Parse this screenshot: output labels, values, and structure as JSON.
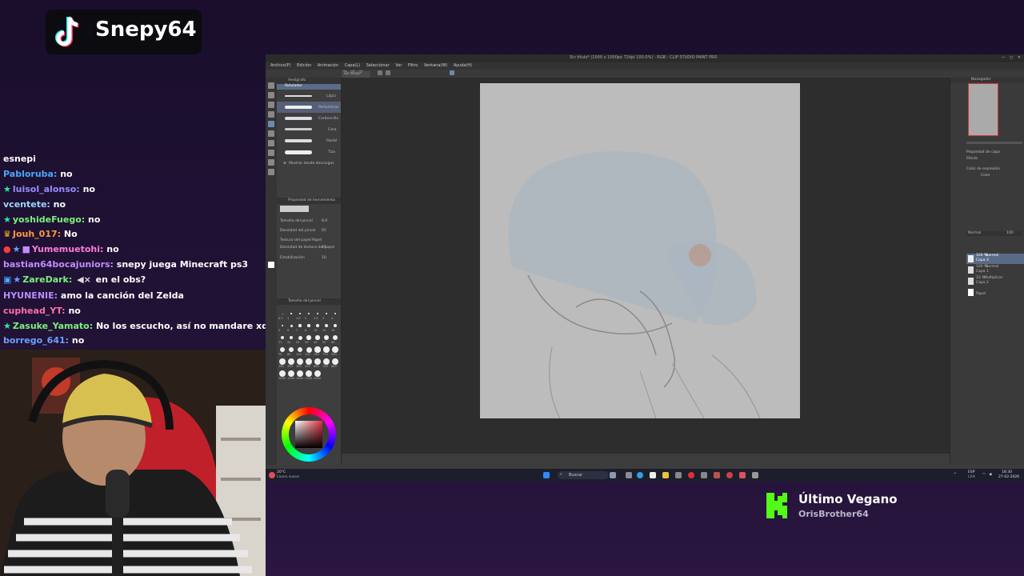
{
  "tiktok": {
    "username": "Snepy64",
    "icon": "tiktok-logo"
  },
  "chat": {
    "messages": [
      {
        "user": "esnepi",
        "text": "",
        "color": "#ffffff",
        "badges": []
      },
      {
        "user": "Pabloruba:",
        "text": "no",
        "color": "#4aa8ff",
        "badges": []
      },
      {
        "user": "luisol_alonso:",
        "text": "no",
        "color": "#9b8cff",
        "badges": [
          "star-icon"
        ]
      },
      {
        "user": "vcentete:",
        "text": "no",
        "color": "#9fd4ff",
        "badges": []
      },
      {
        "user": "yoshideFuego:",
        "text": "no",
        "color": "#7cf07c",
        "badges": [
          "star-icon"
        ]
      },
      {
        "user": "Jouh_017:",
        "text": "No",
        "color": "#ff9a3c",
        "badges": [
          "crown-icon"
        ]
      },
      {
        "user": "Yumemuetohi:",
        "text": "no",
        "color": "#ff7ad9",
        "badges": [
          "warning-icon",
          "star-icon",
          "gift-icon"
        ]
      },
      {
        "user": "bastian64bocajuniors:",
        "text": "snepy juega Minecraft ps3",
        "color": "#c58bff",
        "badges": []
      },
      {
        "user": "ZareDark:",
        "text": "en el obs?",
        "color": "#7cf07c",
        "badges": [
          "badge-icon",
          "star-icon"
        ],
        "extra": "mute-icon"
      },
      {
        "user": "HYUNENIE:",
        "text": "amo la canción del Zelda",
        "color": "#b98cff",
        "badges": []
      },
      {
        "user": "cuphead_YT:",
        "text": "no",
        "color": "#ff6fa8",
        "badges": []
      },
      {
        "user": "Zasuke_Yamato:",
        "text": "No los escucho, así no mandare xd",
        "color": "#7cf07c",
        "badges": [
          "star-icon"
        ]
      },
      {
        "user": "borrego_641:",
        "text": "no",
        "color": "#6aa0ff",
        "badges": []
      }
    ]
  },
  "csp": {
    "window_title": "Sin título* (1000 x 1000px 72dpi 100.0%) - RGB - CLIP STUDIO PAINT PRO",
    "menu": [
      "Archivo(F)",
      "Edición",
      "Animación",
      "Capa(L)",
      "Seleccionar",
      "Ver",
      "Filtro",
      "Ventana(W)",
      "Ayuda(H)"
    ],
    "subtool_header": "Aerógrafo",
    "brush_label": "Rotulador",
    "brush_names": [
      "Lápiz",
      "Portaminas",
      "Carboncillo",
      "Cera",
      "Pastel",
      "Tiza"
    ],
    "download_button": "Mostrar desde descargas",
    "tool_property_header": "Propiedad de herramienta",
    "properties": [
      {
        "label": "Tamaño del pincel",
        "value": "8.0"
      },
      {
        "label": "Densidad del pincel",
        "value": "65"
      },
      {
        "label": "Textura del papel",
        "value": "Papel"
      },
      {
        "label": "Densidad de textura del papel",
        "value": "45"
      },
      {
        "label": "Estabilización",
        "value": "10"
      }
    ],
    "brush_size_header": "Tamaño del pincel",
    "brush_sizes": [
      "0.7",
      "1",
      "1.5",
      "2",
      "2.5",
      "3",
      "4",
      "5",
      "6",
      "7",
      "8",
      "10",
      "12",
      "15",
      "17",
      "20",
      "25",
      "30",
      "40",
      "50",
      "60",
      "70",
      "80",
      "100",
      "120",
      "150",
      "170",
      "200",
      "250",
      "300",
      "400",
      "500",
      "600",
      "700",
      "800",
      "1000",
      "1200",
      "1500",
      "1700",
      "2000"
    ],
    "navigator_label": "Navegador",
    "layer_props_label": "Propiedad de capa",
    "effect_label": "Efecto",
    "expression_color_label": "Color de expresión",
    "expression_color_value": "Color",
    "layer_blend": "Normal",
    "layer_opacity": "100",
    "layers": [
      {
        "opacity": "100 %",
        "mode": "Normal",
        "name": "Capa 3"
      },
      {
        "opacity": "100 %",
        "mode": "Normal",
        "name": "Capa 1"
      },
      {
        "opacity": "23 %",
        "mode": "Multiplicar",
        "name": "Capa 2"
      },
      {
        "opacity": "",
        "mode": "",
        "name": "Papel"
      }
    ]
  },
  "taskbar": {
    "weather": "20°C",
    "weather_desc": "Lluvia suave",
    "search_placeholder": "Buscar",
    "lang": "ESP",
    "lang_sub": "LAA",
    "time": "18:30",
    "date": "27-02-2026"
  },
  "song": {
    "icon": "kick-icon",
    "title": "Último Vegano",
    "artist": "OrisBrother64"
  },
  "colors": {
    "bg": "#1e1133",
    "tiktok_bg": "#0b0b10",
    "kick_green": "#53fc18",
    "csp_panel": "#3c3c3c",
    "canvas_paper": "#bdbdbd"
  }
}
